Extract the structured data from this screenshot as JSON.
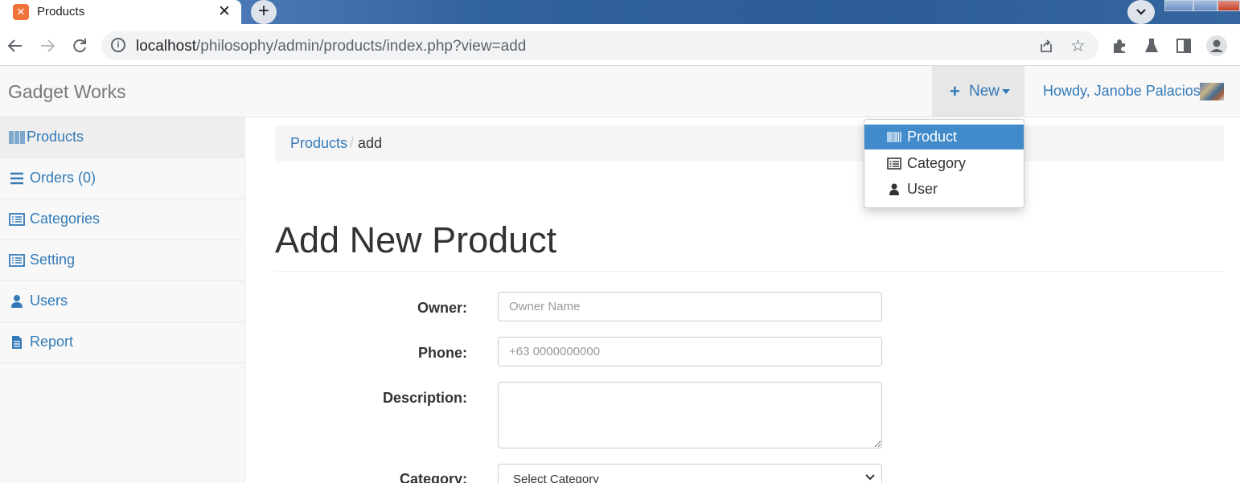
{
  "browser": {
    "tab_title": "Products",
    "tab_favicon": "xampp-icon",
    "url_host": "localhost",
    "url_path": "/philosophy/admin/products/index.php?view=add"
  },
  "navbar": {
    "brand": "Gadget Works",
    "new_label": "New",
    "greeting": "Howdy, Janobe Palacios"
  },
  "new_dropdown": {
    "items": [
      {
        "label": "Product",
        "icon": "barcode-icon",
        "active": true
      },
      {
        "label": "Category",
        "icon": "list-alt-icon",
        "active": false
      },
      {
        "label": "User",
        "icon": "user-icon",
        "active": false
      }
    ]
  },
  "sidebar": {
    "items": [
      {
        "label": "Products",
        "icon": "barcode-icon",
        "active": true
      },
      {
        "label": "Orders (0)",
        "icon": "list-icon",
        "active": false
      },
      {
        "label": "Categories",
        "icon": "list-alt-icon",
        "active": false
      },
      {
        "label": "Setting",
        "icon": "list-alt-icon",
        "active": false
      },
      {
        "label": "Users",
        "icon": "user-icon",
        "active": false
      },
      {
        "label": "Report",
        "icon": "file-icon",
        "active": false
      }
    ]
  },
  "breadcrumb": {
    "parent": "Products",
    "separator": "/",
    "current": "add"
  },
  "page_title": "Add New Product",
  "form": {
    "owner_label": "Owner:",
    "owner_placeholder": "Owner Name",
    "phone_label": "Phone:",
    "phone_placeholder": "+63 0000000000",
    "description_label": "Description:",
    "category_label": "Category:",
    "category_selected": "Select Category"
  },
  "colors": {
    "link": "#337ab7",
    "dropdown_active": "#428bca",
    "navbar_bg": "#f8f8f8"
  }
}
